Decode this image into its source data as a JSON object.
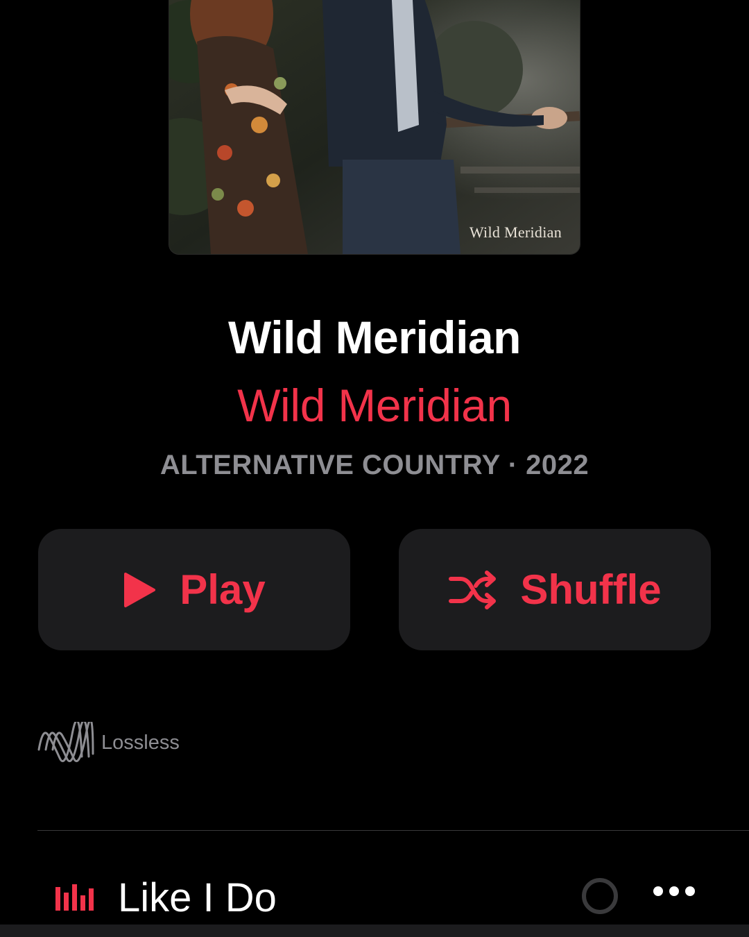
{
  "artwork": {
    "caption": "Wild Meridian",
    "alt": "Album cover photo"
  },
  "album": {
    "title": "Wild Meridian",
    "artist": "Wild Meridian",
    "meta": "ALTERNATIVE COUNTRY · 2022"
  },
  "actions": {
    "play_label": "Play",
    "shuffle_label": "Shuffle"
  },
  "badge": {
    "lossless_label": "Lossless"
  },
  "tracks": [
    {
      "title": "Like I Do",
      "playing": true
    }
  ],
  "colors": {
    "accent": "#f2334a",
    "background": "#000000",
    "button_bg": "#1c1c1e",
    "secondary_text": "#8e8e93"
  },
  "icons": {
    "play": "play-icon",
    "shuffle": "shuffle-icon",
    "lossless": "lossless-wave-icon",
    "now_playing": "now-playing-bars-icon",
    "download": "download-progress-icon",
    "more": "more-ellipsis-icon"
  }
}
